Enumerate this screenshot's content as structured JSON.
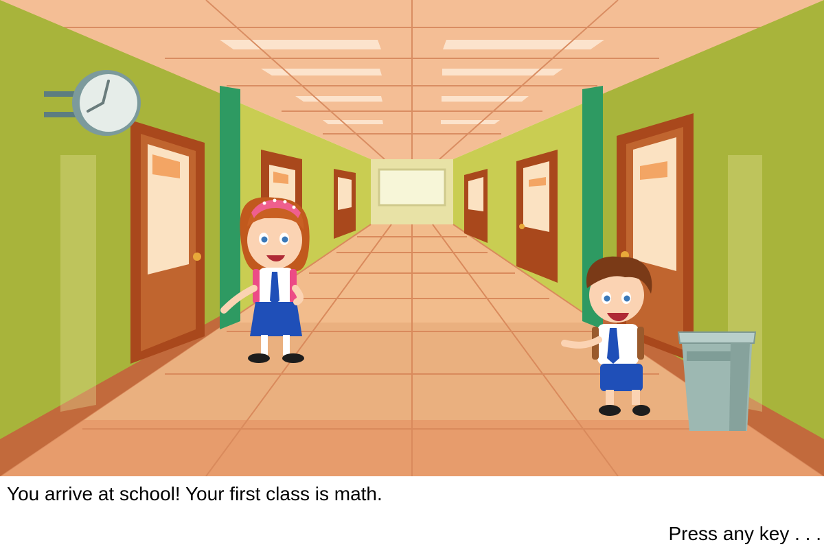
{
  "scene": {
    "name": "school-hallway",
    "colors": {
      "wall": "#a9b83c",
      "wall_light": "#d6da6a",
      "floor": "#f1b98a",
      "floor_dark": "#d96e45",
      "ceiling": "#f6c39a",
      "door": "#b4501f",
      "pillar": "#2e9a62",
      "trash_can": "#9fb9b4",
      "uniform_blue": "#1f4fb8"
    },
    "characters": [
      "girl-student",
      "boy-student"
    ]
  },
  "dialogue": {
    "narration": "You arrive at school! Your first class is math.",
    "prompt": "Press any key . . ."
  }
}
